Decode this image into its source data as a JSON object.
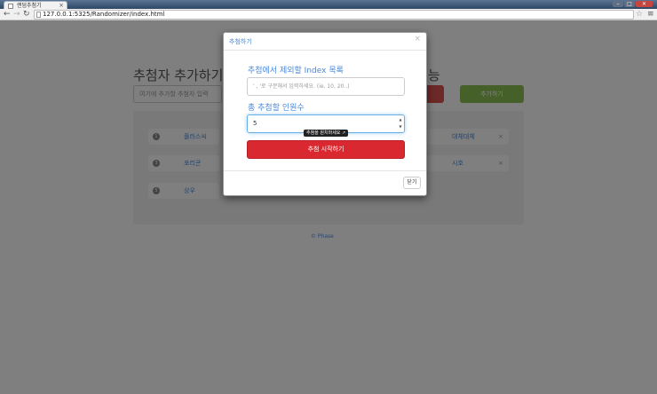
{
  "browser": {
    "tab_title": "랜덤추첨기",
    "url": "127.0.0.1:5325/Randomizer/index.html",
    "tab_close": "×"
  },
  "page": {
    "title_left": "추첨자 추가하기",
    "title_right": "능",
    "add_placeholder": "여기에 추가할 추첨자 입력",
    "add_button": "추가하기",
    "footer": "© Phase",
    "people_left": [
      {
        "num": "1",
        "name": "플러스씨"
      },
      {
        "num": "3",
        "name": "포리콘"
      },
      {
        "num": "5",
        "name": "상우"
      }
    ],
    "people_right": [
      {
        "name": "대체대체",
        "del": "×"
      },
      {
        "name": "시호",
        "del": "×"
      }
    ]
  },
  "modal": {
    "title": "추첨하기",
    "close_x": "×",
    "exclude_label": "추첨에서 제외할 Index 목록",
    "exclude_placeholder": "' , '로 구분해서 입력하세요. (ie. 10, 20..)",
    "count_label": "총 추첨할 인원수",
    "count_value": "5",
    "tooltip": "추첨을 원치마세요 ↗",
    "start_button": "추첨 시작하기",
    "close_button": "닫기"
  },
  "colors": {
    "accent": "#4a89dc",
    "danger": "#d9282f",
    "success": "#8cc152"
  }
}
